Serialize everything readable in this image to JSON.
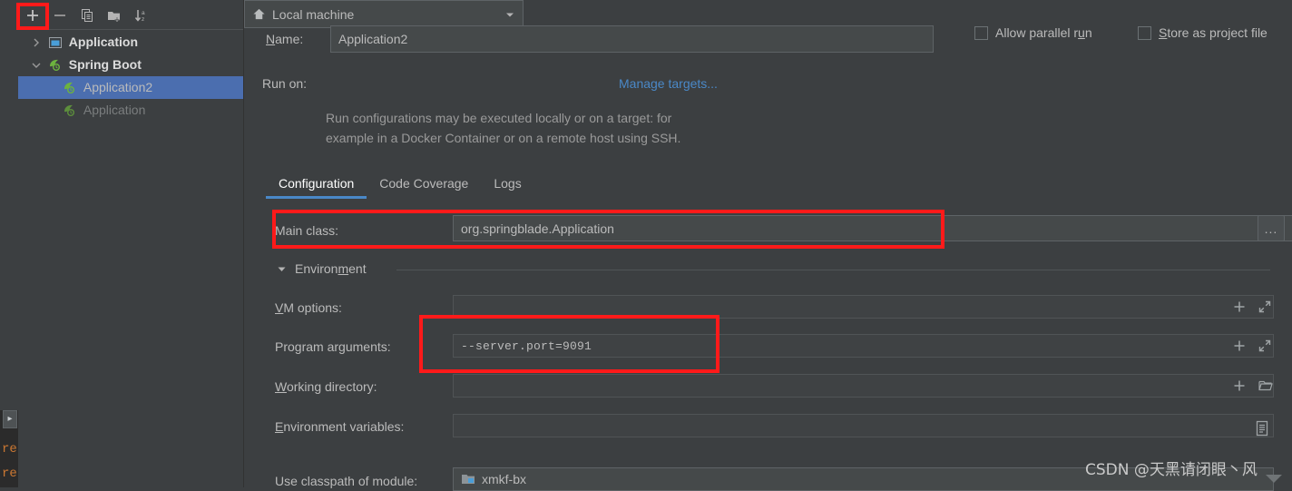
{
  "toolbar": {
    "add": "add-icon",
    "remove": "remove-icon",
    "copy": "copy-icon",
    "folder": "new-folder-icon",
    "sort": "sort-alphabetical-icon"
  },
  "tree": {
    "groups": [
      {
        "label": "Application",
        "icon": "application-icon",
        "expanded": false
      },
      {
        "label": "Spring Boot",
        "icon": "spring-boot-icon",
        "expanded": true
      }
    ],
    "children": [
      {
        "label": "Application2",
        "icon": "spring-boot-icon",
        "selected": true
      },
      {
        "label": "Application",
        "icon": "spring-boot-icon",
        "selected": false
      }
    ]
  },
  "form": {
    "name_label": "Name:",
    "name_value": "Application2",
    "run_on_label": "Run on:",
    "run_on_value": "Local machine",
    "manage_targets": "Manage targets...",
    "allow_parallel_run": "Allow parallel run",
    "store_as_project_file": "Store as project file",
    "description_line1": "Run configurations may be executed locally or on a target: for",
    "description_line2": "example in a Docker Container or on a remote host using SSH."
  },
  "tabs": [
    {
      "label": "Configuration",
      "active": true
    },
    {
      "label": "Code Coverage",
      "active": false
    },
    {
      "label": "Logs",
      "active": false
    }
  ],
  "configuration": {
    "main_class_label": "Main class:",
    "main_class_value": "org.springblade.Application",
    "browse_button": "...",
    "environment_section": "Environment",
    "vm_options_label": "VM options:",
    "vm_options_value": "",
    "program_arguments_label": "Program arguments:",
    "program_arguments_value": "--server.port=9091",
    "working_directory_label": "Working directory:",
    "working_directory_value": "",
    "environment_variables_label": "Environment variables:",
    "environment_variables_value": "",
    "classpath_module_label": "Use classpath of module:",
    "classpath_module_value": "xmkf-bx"
  },
  "annotations": {
    "color": "#ff1a1a",
    "boxes": [
      "add-configuration-button",
      "main-class-row",
      "program-arguments-row"
    ]
  },
  "colors": {
    "background": "#3c3f41",
    "field_background": "#45494a",
    "selection": "#4b6eaf",
    "link": "#4a88c7",
    "accent_tab": "#4a88c7",
    "spring_green": "#6db33f",
    "annotation_red": "#ff1a1a"
  },
  "editor_strip": {
    "toggle": "expand-arrow-icon",
    "code_line1": "re",
    "code_line2": "re"
  },
  "watermark": "CSDN @天黑请闭眼丶风"
}
